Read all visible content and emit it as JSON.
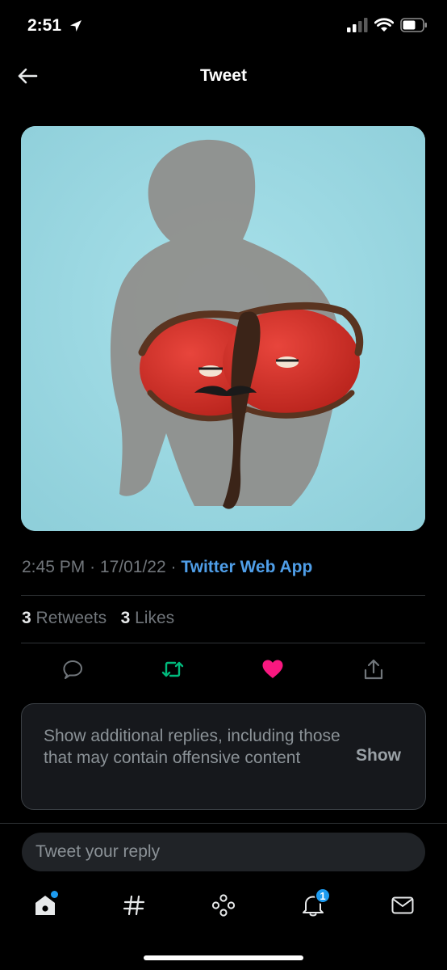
{
  "status_bar": {
    "time": "2:51"
  },
  "header": {
    "title": "Tweet"
  },
  "tweet": {
    "time": "2:45 PM",
    "separator": "·",
    "date": "17/01/22",
    "source": "Twitter Web App",
    "retweets_count": "3",
    "retweets_label": "Retweets",
    "likes_count": "3",
    "likes_label": "Likes"
  },
  "actions": [
    {
      "icon": "reply-icon"
    },
    {
      "icon": "retweet-icon",
      "color": "#00ba7c"
    },
    {
      "icon": "like-icon",
      "color": "#f91880"
    },
    {
      "icon": "share-icon"
    }
  ],
  "replies_notice": {
    "text": "Show additional replies, including those that may contain offensive content",
    "button_label": "Show"
  },
  "reply": {
    "placeholder": "Tweet your reply"
  },
  "tab_bar": {
    "items": [
      {
        "icon": "home-icon",
        "active": true,
        "has_dot": true
      },
      {
        "icon": "hashtag-icon"
      },
      {
        "icon": "spaces-icon"
      },
      {
        "icon": "bell-icon",
        "badge": "1"
      },
      {
        "icon": "mail-icon"
      }
    ]
  },
  "colors": {
    "accent": "#1d9bf0",
    "link": "#4f9ee8",
    "image_background": "#9fdbe4"
  }
}
